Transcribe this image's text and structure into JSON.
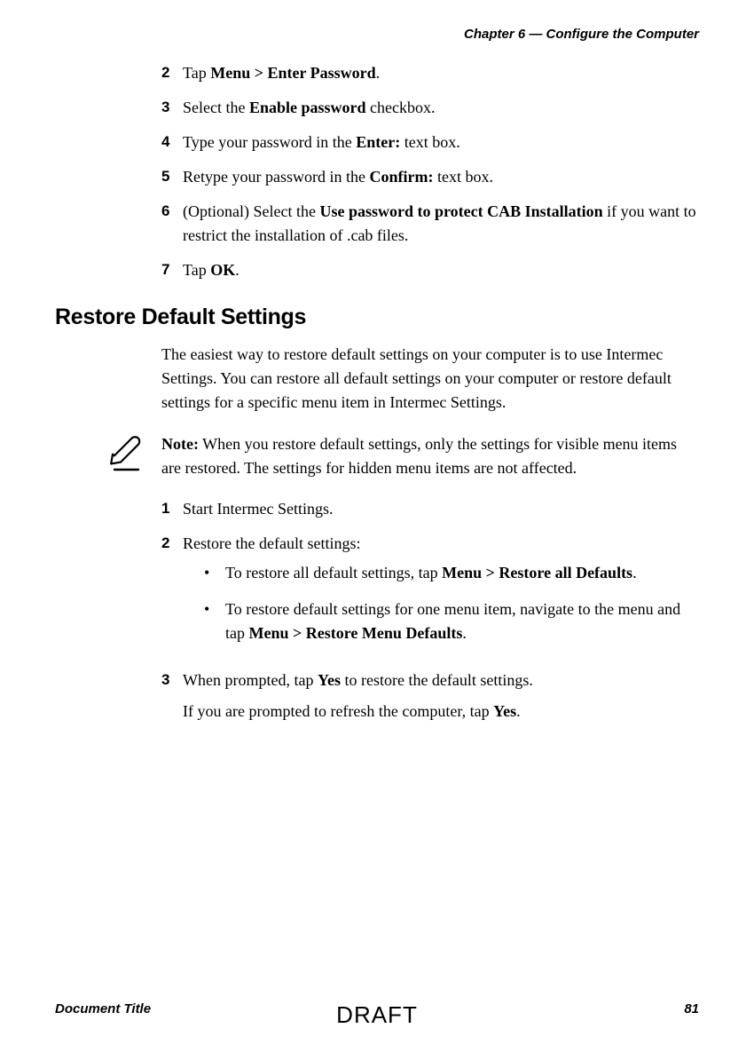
{
  "header": {
    "chapter": "Chapter 6 — Configure the Computer"
  },
  "steps1": [
    {
      "n": "2",
      "pre": "Tap ",
      "bold": "Menu > Enter Password",
      "post": "."
    },
    {
      "n": "3",
      "pre": "Select the ",
      "bold": "Enable password",
      "post": " checkbox."
    },
    {
      "n": "4",
      "pre": "Type your password in the ",
      "bold": "Enter:",
      "post": " text box."
    },
    {
      "n": "5",
      "pre": "Retype your password in the ",
      "bold": "Confirm:",
      "post": " text box."
    },
    {
      "n": "6",
      "pre": "(Optional) Select the ",
      "bold": "Use password to protect CAB Installation",
      "post": " if you want to restrict the installation of .cab files."
    },
    {
      "n": "7",
      "pre": "Tap ",
      "bold": "OK",
      "post": "."
    }
  ],
  "section1": {
    "heading": "Restore Default Settings",
    "intro": "The easiest way to restore default settings on your computer is to use Intermec Settings. You can restore all default settings on your computer or restore default settings for a specific menu item in Intermec Settings."
  },
  "note": {
    "label": "Note:",
    "text": " When you restore default settings, only the settings for visible menu items are restored. The settings for hidden menu items are not affected."
  },
  "steps2": [
    {
      "n": "1",
      "plain": "Start Intermec Settings."
    },
    {
      "n": "2",
      "plain": "Restore the default settings:"
    }
  ],
  "bullets": [
    {
      "pre": "To restore all default settings, tap ",
      "bold": "Menu > Restore all Defaults",
      "post": "."
    },
    {
      "pre": "To restore default settings for one menu item, navigate to the menu and tap ",
      "bold": "Menu > Restore Menu Defaults",
      "post": "."
    }
  ],
  "step3": {
    "n": "3",
    "pre": "When prompted, tap ",
    "bold": "Yes",
    "post": " to restore the default settings.",
    "followup_pre": "If you are prompted to refresh the computer, tap ",
    "followup_bold": "Yes",
    "followup_post": "."
  },
  "footer": {
    "left": "Document Title",
    "center": "DRAFT",
    "right": "81"
  }
}
